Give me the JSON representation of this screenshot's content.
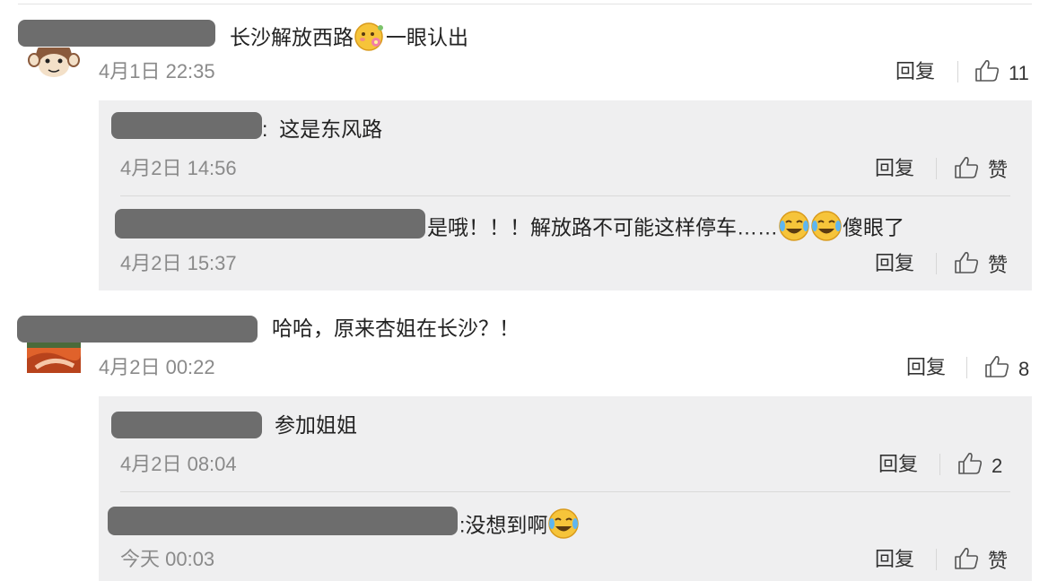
{
  "comments": [
    {
      "text_before": "长沙解放西路",
      "emoji_mid": "flower-shy-emoji",
      "text_after": "一眼认出",
      "time": "4月1日 22:35",
      "reply_label": "回复",
      "like_count": "11",
      "replies": [
        {
          "prefix": ":",
          "text": "这是东风路",
          "time": "4月2日 14:56",
          "reply_label": "回复",
          "like_label": "赞"
        },
        {
          "prefix": "",
          "text": "是哦！！！解放路不可能这样停车……",
          "text_tail": "傻眼了",
          "time": "4月2日 15:37",
          "reply_label": "回复",
          "like_label": "赞"
        }
      ]
    },
    {
      "text": "哈哈，原来杏姐在长沙？！",
      "time": "4月2日 00:22",
      "reply_label": "回复",
      "like_count": "8",
      "replies": [
        {
          "text": "参加姐姐",
          "time": "4月2日 08:04",
          "reply_label": "回复",
          "like_count": "2"
        },
        {
          "prefix": ":",
          "text": "没想到啊",
          "time": "今天 00:03",
          "reply_label": "回复",
          "like_label": "赞"
        }
      ]
    }
  ],
  "colors": {
    "panel_bg": "#efeff0",
    "redaction": "#6d6d6d",
    "time_text": "#8a8a8a"
  }
}
